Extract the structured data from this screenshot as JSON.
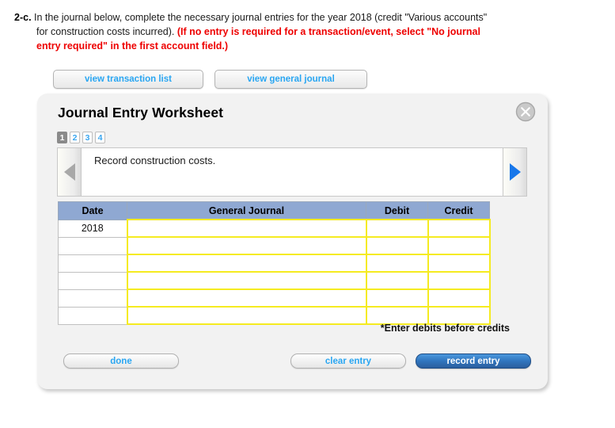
{
  "question": {
    "number": "2-c.",
    "text_normal_1": "In the journal below, complete the necessary journal entries for the year 2018 (credit \"Various accounts\" for construction costs incurred). ",
    "text_red": "(If no entry is required for a transaction/event, select \"No journal entry required\" in the first account field.)"
  },
  "view_buttons": {
    "transaction_list": "view transaction list",
    "general_journal": "view general journal"
  },
  "panel": {
    "title": "Journal Entry Worksheet",
    "close_icon": "close-circle-icon",
    "pager": [
      {
        "label": "1",
        "active": true
      },
      {
        "label": "2",
        "active": false
      },
      {
        "label": "3",
        "active": false
      },
      {
        "label": "4",
        "active": false
      }
    ],
    "prev_icon": "triangle-left-icon",
    "next_icon": "triangle-right-icon",
    "prompt_text": "Record construction costs.",
    "note": "*Enter debits before credits"
  },
  "table": {
    "headers": [
      "Date",
      "General Journal",
      "Debit",
      "Credit"
    ],
    "rows": [
      {
        "date": "2018",
        "general_journal": "",
        "debit": "",
        "credit": ""
      },
      {
        "date": "",
        "general_journal": "",
        "debit": "",
        "credit": ""
      },
      {
        "date": "",
        "general_journal": "",
        "debit": "",
        "credit": ""
      },
      {
        "date": "",
        "general_journal": "",
        "debit": "",
        "credit": ""
      },
      {
        "date": "",
        "general_journal": "",
        "debit": "",
        "credit": ""
      },
      {
        "date": "",
        "general_journal": "",
        "debit": "",
        "credit": ""
      }
    ]
  },
  "footer": {
    "done": "done",
    "clear_entry": "clear entry",
    "record_entry": "record entry"
  },
  "colors": {
    "link_blue": "#29a6f2",
    "alert_red": "#ee0000",
    "header_blue": "#8fa8d2",
    "field_yellow": "#f5eb20",
    "primary_button": "#3176bf",
    "panel_background": "#f2f2f2"
  }
}
